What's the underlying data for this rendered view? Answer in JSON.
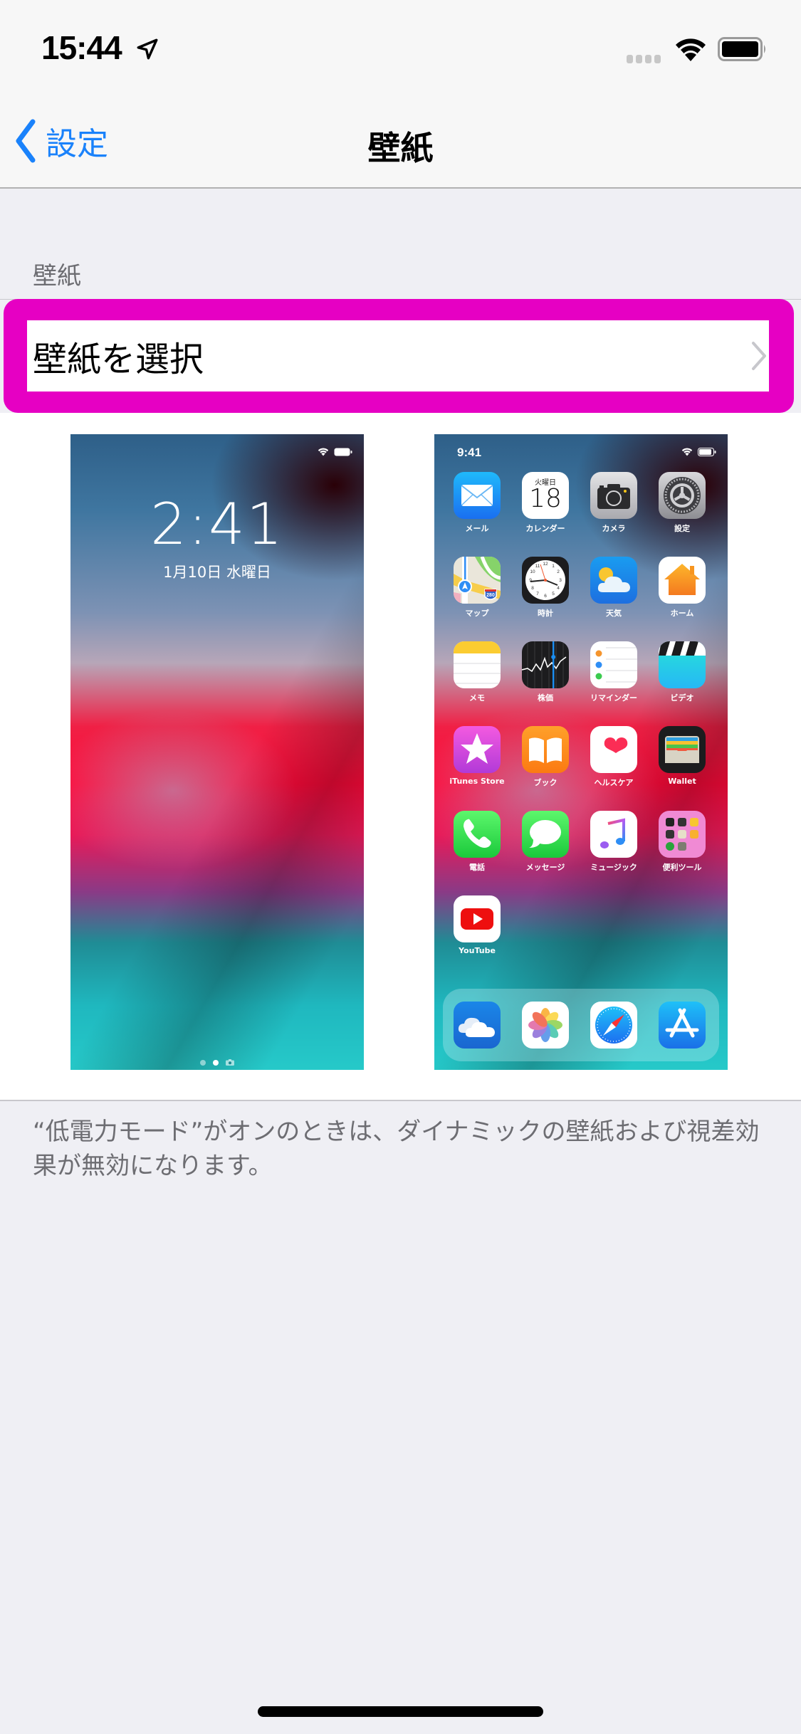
{
  "status_bar": {
    "time": "15:44",
    "icons": [
      "location-arrow-icon",
      "cellular-signal-icon",
      "wifi-icon",
      "battery-icon"
    ]
  },
  "nav_bar": {
    "back_label": "設定",
    "title": "壁紙"
  },
  "section": {
    "header": "壁紙",
    "row_label": "壁紙を選択",
    "highlight_color": "#e600c3"
  },
  "lock_preview": {
    "time": "2:41",
    "date": "1月10日 水曜日"
  },
  "home_preview": {
    "time": "9:41",
    "apps": [
      {
        "label": "メール",
        "icon": "mail-icon"
      },
      {
        "label": "カレンダー",
        "icon": "calendar-icon",
        "weekday": "火曜日",
        "day": "18"
      },
      {
        "label": "カメラ",
        "icon": "camera-icon"
      },
      {
        "label": "設定",
        "icon": "settings-icon"
      },
      {
        "label": "マップ",
        "icon": "maps-icon",
        "badge": "280"
      },
      {
        "label": "時計",
        "icon": "clock-icon"
      },
      {
        "label": "天気",
        "icon": "weather-icon"
      },
      {
        "label": "ホーム",
        "icon": "home-app-icon"
      },
      {
        "label": "メモ",
        "icon": "notes-icon"
      },
      {
        "label": "株価",
        "icon": "stocks-icon"
      },
      {
        "label": "リマインダー",
        "icon": "reminders-icon"
      },
      {
        "label": "ビデオ",
        "icon": "videos-icon"
      },
      {
        "label": "iTunes Store",
        "icon": "itunes-store-icon"
      },
      {
        "label": "ブック",
        "icon": "books-icon"
      },
      {
        "label": "ヘルスケア",
        "icon": "health-icon"
      },
      {
        "label": "Wallet",
        "icon": "wallet-icon"
      },
      {
        "label": "電話",
        "icon": "phone-icon"
      },
      {
        "label": "メッセージ",
        "icon": "messages-icon"
      },
      {
        "label": "ミュージック",
        "icon": "music-icon"
      },
      {
        "label": "便利ツール",
        "icon": "utilities-folder-icon"
      },
      {
        "label": "YouTube",
        "icon": "youtube-icon"
      }
    ],
    "dock": [
      {
        "icon": "icloud-drive-icon"
      },
      {
        "icon": "photos-icon"
      },
      {
        "icon": "safari-icon"
      },
      {
        "icon": "app-store-icon"
      }
    ]
  },
  "footer": {
    "text": "“低電力モード”がオンのときは、ダイナミックの壁紙および視差効果が無効になります。"
  },
  "colors": {
    "accent": "#1a82fb",
    "background": "#efeff4",
    "secondary_text": "#6d6d72"
  }
}
